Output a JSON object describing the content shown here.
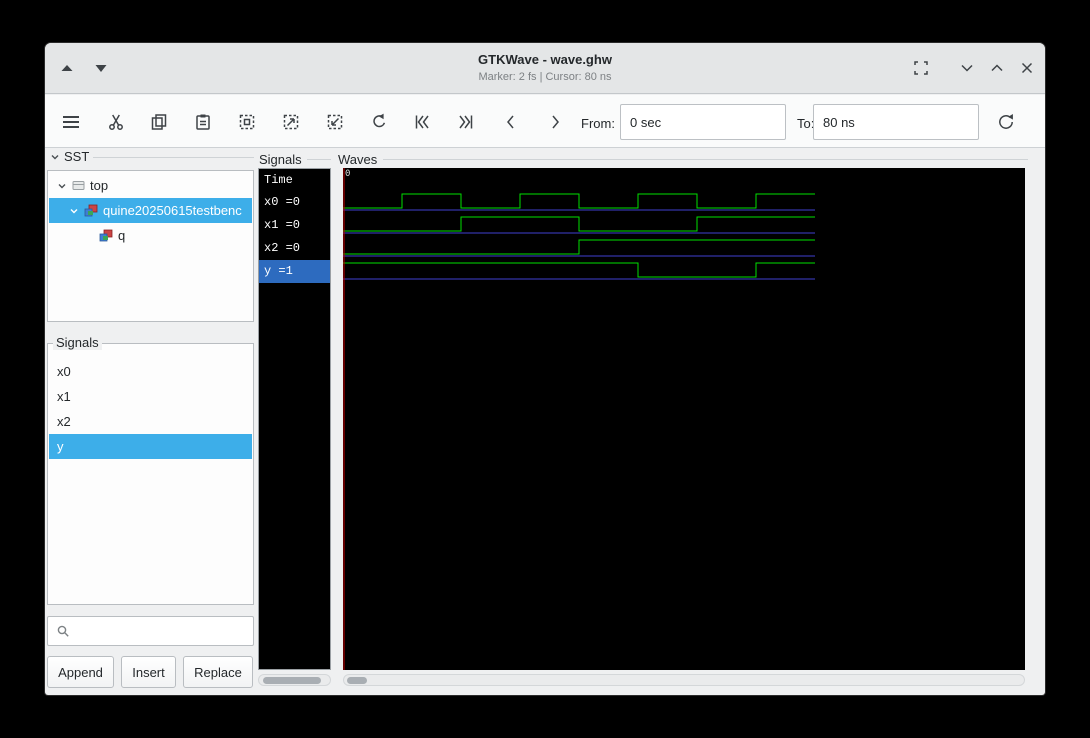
{
  "window": {
    "title": "GTKWave - wave.ghw",
    "subtitle": "Marker: 2 fs | Cursor: 80 ns"
  },
  "titlebar_icons": [
    "scroll-up",
    "scroll-down",
    "fit-screen",
    "chevron-down",
    "chevron-up",
    "close"
  ],
  "toolbar": {
    "icons": [
      "menu",
      "cut",
      "copy",
      "paste",
      "zoom-fit",
      "zoom-in",
      "zoom-out",
      "undo",
      "skip-to-start",
      "skip-to-end",
      "step-back",
      "step-forward",
      "reload"
    ],
    "from_label": "From:",
    "from_value": "0 sec",
    "to_label": "To:",
    "to_value": "80 ns"
  },
  "sst_panel": {
    "label": "SST",
    "tree": [
      {
        "label": "top",
        "icon": "module-icon",
        "expanded": true,
        "selected": false
      },
      {
        "label": "quine20250615testbenc",
        "icon": "component-icon",
        "expanded": true,
        "selected": true
      },
      {
        "label": "q",
        "icon": "component-icon",
        "expanded": false,
        "selected": false
      }
    ]
  },
  "facs_panel": {
    "label": "Signals",
    "items": [
      "x0",
      "x1",
      "x2",
      "y"
    ],
    "selected_item": "y",
    "search_placeholder": "",
    "buttons": {
      "append": "Append",
      "insert": "Insert",
      "replace": "Replace"
    }
  },
  "signal_list": {
    "label": "Signals",
    "header": "Time",
    "rows": [
      {
        "text": "x0 =0",
        "selected": false
      },
      {
        "text": "x1 =0",
        "selected": false
      },
      {
        "text": "x2 =0",
        "selected": false
      },
      {
        "text": "y =1",
        "selected": true
      }
    ]
  },
  "waves_panel": {
    "label": "Waves",
    "timescale_origin": "0"
  },
  "chart_data": {
    "type": "digital-waveform",
    "title": "GTKWave traces for wave.ghw",
    "time_unit": "ns",
    "t_start": 0,
    "t_end": 80,
    "step_ns": 10,
    "signals": [
      {
        "name": "x0",
        "values": [
          0,
          1,
          0,
          1,
          0,
          1,
          0,
          1
        ]
      },
      {
        "name": "x1",
        "values": [
          0,
          0,
          1,
          1,
          0,
          0,
          1,
          1
        ]
      },
      {
        "name": "x2",
        "values": [
          0,
          0,
          0,
          0,
          1,
          1,
          1,
          1
        ]
      },
      {
        "name": "y",
        "values": [
          1,
          1,
          1,
          1,
          1,
          0,
          0,
          1
        ]
      }
    ],
    "marker_time_ns": 0,
    "colors": {
      "trace": "#00e000",
      "baseline": "#4040d0",
      "marker": "#c80000",
      "background": "#000000",
      "selection": "#2d6bbf",
      "accent": "#3daee9"
    }
  }
}
